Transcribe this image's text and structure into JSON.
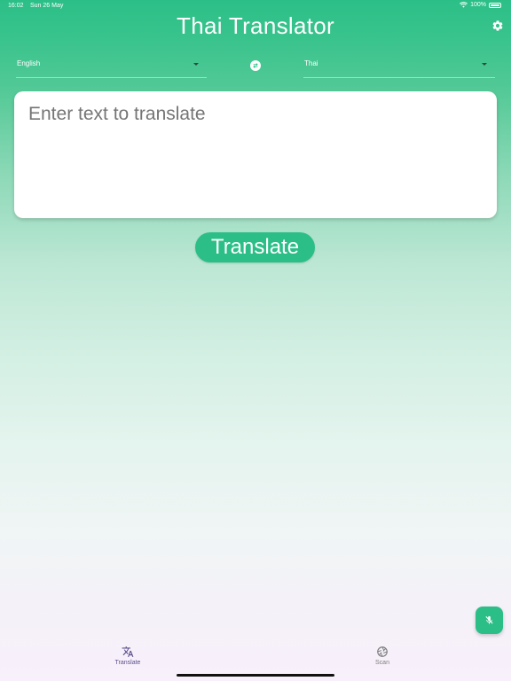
{
  "status_bar": {
    "time": "16:02",
    "date": "Sun 26 May",
    "battery": "100%"
  },
  "header": {
    "title": "Thai Translator",
    "settings_icon": "gear-icon"
  },
  "languages": {
    "source": "English",
    "target": "Thai",
    "swap_icon": "swap-icon"
  },
  "input": {
    "placeholder": "Enter text to translate",
    "value": ""
  },
  "actions": {
    "translate_label": "Translate",
    "mic_icon": "mic-off-icon"
  },
  "bottom_nav": {
    "items": [
      {
        "label": "Translate",
        "icon": "translate-icon",
        "active": true
      },
      {
        "label": "Scan",
        "icon": "camera-shutter-icon",
        "active": false
      }
    ]
  },
  "colors": {
    "accent": "#2bbf87",
    "active_nav": "#5b4e8c",
    "inactive_nav": "#7c7c7c"
  }
}
